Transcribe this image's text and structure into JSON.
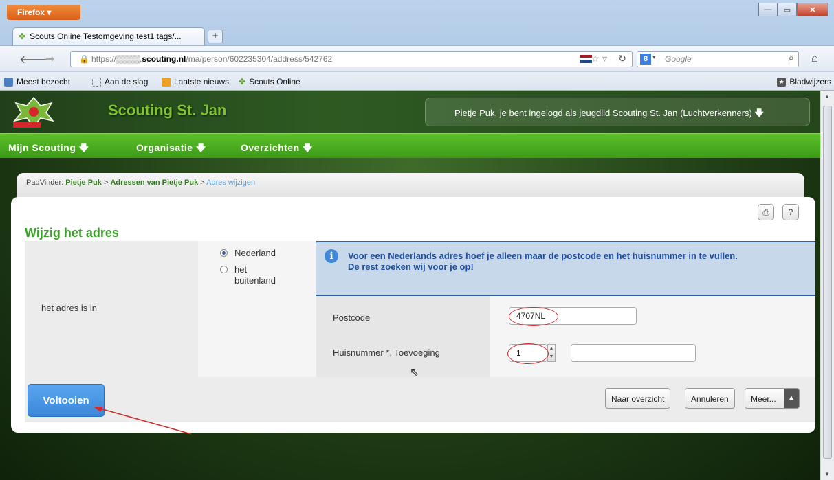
{
  "browser": {
    "app_button": "Firefox",
    "tab_title": "Scouts Online Testomgeving test1 tags/...",
    "new_tab": "+",
    "url_prefix": "https://",
    "url_host": "scouting.nl",
    "url_path": "/ma/person/602235304/address/542762",
    "search_placeholder": "Google",
    "bookmarks": [
      "Meest bezocht",
      "Aan de slag",
      "Laatste nieuws",
      "Scouts Online"
    ],
    "bookmarks_menu": "Bladwijzers"
  },
  "site": {
    "title": "Scouting St. Jan",
    "login_text": "Pietje Puk, je bent ingelogd als jeugdlid Scouting St. Jan (Luchtverkenners)",
    "menu": [
      "Mijn Scouting",
      "Organisatie",
      "Overzichten"
    ]
  },
  "breadcrumb": {
    "prefix": "PadVinder:",
    "items": [
      "Pietje Puk",
      "Adressen van Pietje Puk"
    ],
    "separator": ">",
    "current": "Adres wijzigen"
  },
  "form": {
    "title": "Wijzig het adres",
    "label": "het adres is in",
    "radio_options": [
      {
        "label": "Nederland",
        "selected": true
      },
      {
        "label": "het buitenland",
        "selected": false
      }
    ],
    "info_line1": "Voor een Nederlands adres hoef je alleen maar de postcode en het huisnummer in te vullen.",
    "info_line2": "De rest zoeken wij voor je op!",
    "postcode_label": "Postcode",
    "postcode_value": "4707NL",
    "huisnummer_label": "Huisnummer *, Toevoeging",
    "huisnummer_value": "1",
    "toevoeging_value": ""
  },
  "actions": {
    "primary": "Voltooien",
    "overview": "Naar overzicht",
    "cancel": "Annuleren",
    "more": "Meer..."
  },
  "colors": {
    "menu_green": "#4aad20",
    "title_green": "#3aa12a",
    "info_blue": "#1f4f9d",
    "primary_blue": "#3c87d8",
    "annotation_red": "#d12a2a"
  }
}
